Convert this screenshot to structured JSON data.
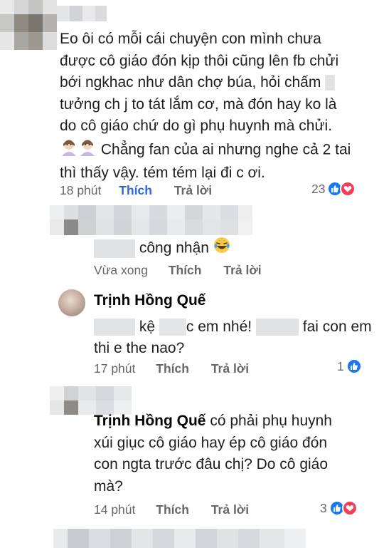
{
  "comments": [
    {
      "text_lines": [
        "Eo ôi có mỗi cái chuyện con mình chưa",
        "được cô giáo đón kịp thôi cũng lên fb chửi",
        "bới ngkhac như dân chợ búa, hỏi chấm",
        "tưởng ch j to tát lắm cơ, mà đón hay ko là",
        "do cô giáo chứ do gì phụ huynh mà chửi.",
        "Chẳng fan của ai nhưng nghe cả 2 tai",
        "thì thấy vậy. tém tém lại đi c ơi."
      ],
      "time": "18 phút",
      "like": "Thích",
      "reply": "Trả lời",
      "reaction_count": "23"
    },
    {
      "text": "công nhận",
      "time": "Vừa xong",
      "like": "Thích",
      "reply": "Trả lời"
    },
    {
      "author": "Trịnh Hồng Quế",
      "text_line1_a": "kệ",
      "text_line1_b": "c em nhé!",
      "text_line1_c": "fai con em",
      "text_line2": "thi e the nao?",
      "time": "17 phút",
      "like": "Thích",
      "reply": "Trả lời",
      "reaction_count": "1"
    },
    {
      "author": "Trịnh Hồng Quế",
      "text_line1": "có phải phụ huynh",
      "text_lines": [
        "xúi giục cô giáo hay ép cô giáo đón",
        "con ngta trước đâu chị? Do cô giáo",
        "mà?"
      ],
      "time": "14 phút",
      "like": "Thích",
      "reply": "Trả lời",
      "reaction_count": "3"
    }
  ],
  "icons": {
    "like": "thumbs-up-icon",
    "love": "heart-icon",
    "emoji_laugh": "laughing-tears-emoji",
    "emoji_person": "person-raising-hand-emoji"
  },
  "colors": {
    "link_blue": "#2d66d9",
    "meta_gray": "#65676b",
    "like_blue": "#1877f2",
    "love_red": "#f33e58"
  }
}
